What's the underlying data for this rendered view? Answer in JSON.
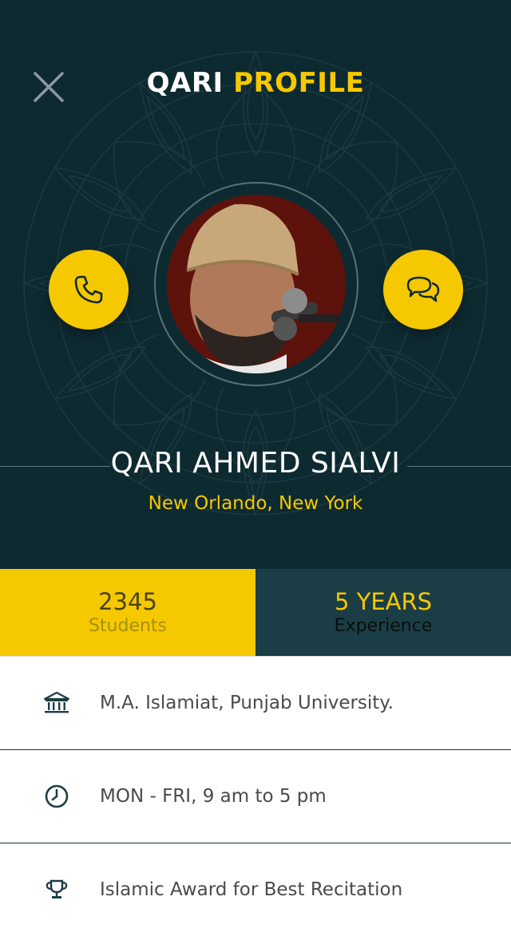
{
  "header": {
    "title_part1": "QARI",
    "title_part2": "PROFILE"
  },
  "profile": {
    "name": "QARI AHMED SIALVI",
    "location": "New Orlando, New York",
    "avatar_alt": "Qari portrait"
  },
  "stats": {
    "students_value": "2345",
    "students_label": "Students",
    "experience_value": "5 YEARS",
    "experience_label": "Experience"
  },
  "details": [
    {
      "icon": "university-icon",
      "text": "M.A. Islamiat, Punjab University."
    },
    {
      "icon": "clock-icon",
      "text": "MON - FRI, 9 am to 5 pm"
    },
    {
      "icon": "trophy-icon",
      "text": "Islamic Award for Best Recitation"
    }
  ],
  "colors": {
    "background": "#0e2a31",
    "accent": "#f6c800",
    "stat_dark": "#1b3d45"
  }
}
